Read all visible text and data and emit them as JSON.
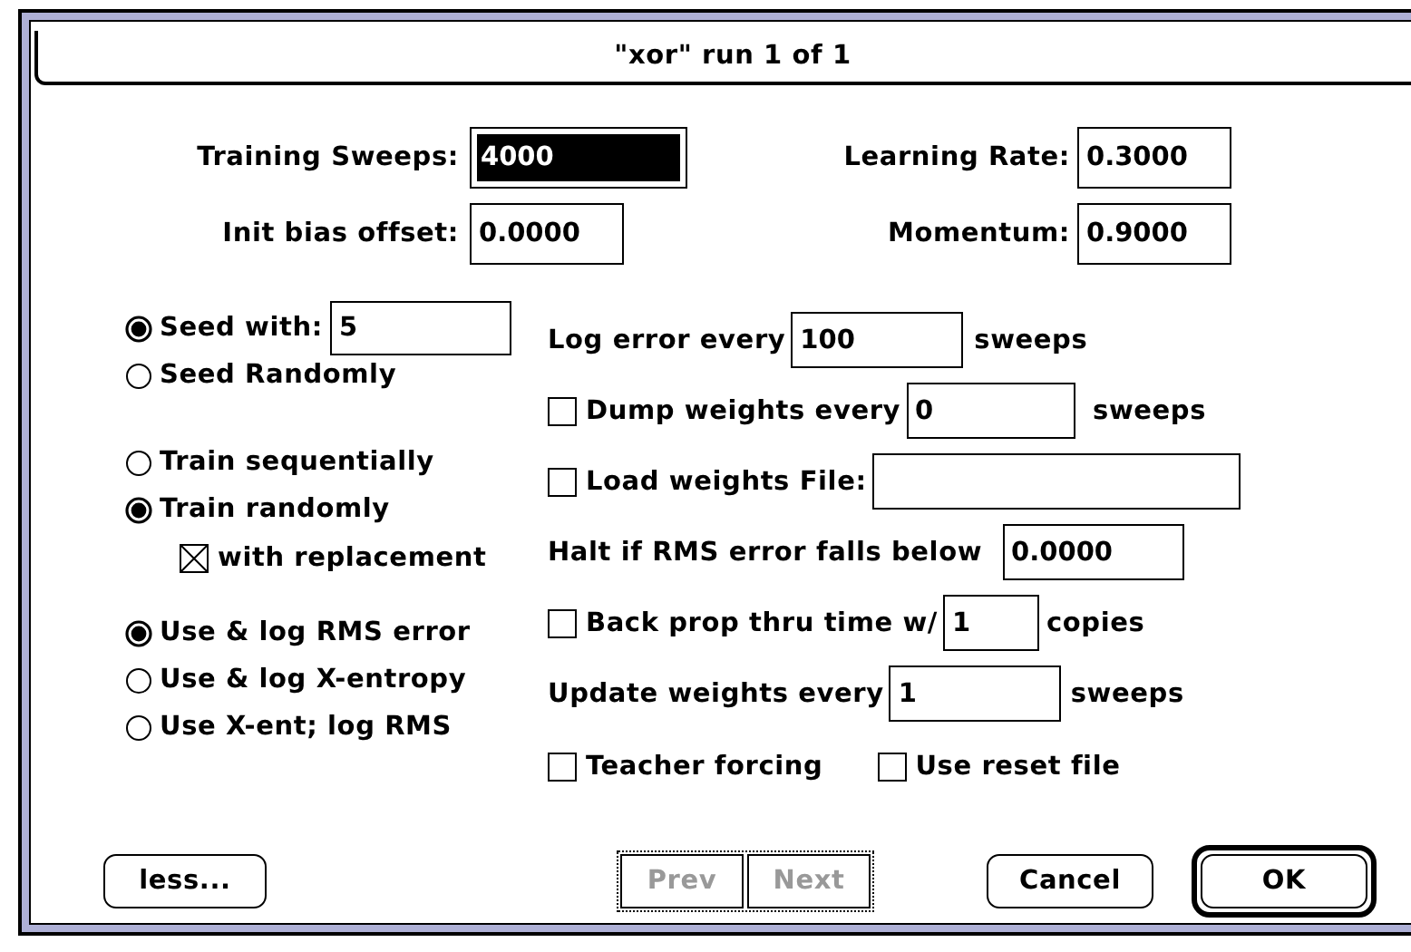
{
  "window": {
    "title": "\"xor\" run 1 of 1"
  },
  "parameters": [
    {
      "label": "Training Sweeps:",
      "value": "4000",
      "selected": true
    },
    {
      "label": "Learning Rate:",
      "value": "0.3000",
      "selected": false
    },
    {
      "label": "Init bias offset:",
      "value": "0.0000",
      "selected": false
    },
    {
      "label": "Momentum:",
      "value": "0.9000",
      "selected": false
    }
  ],
  "seed_options": [
    {
      "label": "Seed with:",
      "selected": true,
      "value": "5"
    },
    {
      "label": "Seed Randomly",
      "selected": false
    }
  ],
  "order_options": [
    {
      "label": "Train sequentially",
      "selected": false
    },
    {
      "label": "Train randomly",
      "selected": true
    }
  ],
  "with_replacement": {
    "label": "with replacement",
    "checked": true
  },
  "error_options": [
    {
      "label": "Use & log RMS error",
      "selected": true
    },
    {
      "label": "Use & log X-entropy",
      "selected": false
    },
    {
      "label": "Use X-ent; log RMS",
      "selected": false
    }
  ],
  "settings": [
    {
      "kind": "field",
      "label": "Log error every",
      "value": "100",
      "unit": "sweeps"
    },
    {
      "kind": "check_field",
      "checked": false,
      "label": "Dump weights every",
      "value": "0",
      "unit": "sweeps"
    },
    {
      "kind": "check_field",
      "checked": false,
      "label": "Load weights File:"
    },
    {
      "kind": "field",
      "label": "Halt if RMS error falls below",
      "value": "0.0000"
    },
    {
      "kind": "check_field",
      "checked": false,
      "label": "Back prop thru time w/",
      "value": "1",
      "unit": "copies"
    },
    {
      "kind": "field",
      "label": "Update weights every",
      "value": "1",
      "unit": "sweeps"
    }
  ],
  "options": [
    {
      "label": "Teacher forcing",
      "checked": false
    },
    {
      "label": "Use reset file",
      "checked": false
    }
  ],
  "buttons": [
    {
      "label": "less...",
      "disabled": false,
      "default": false
    },
    {
      "label": "Prev",
      "disabled": true
    },
    {
      "label": "Next",
      "disabled": true
    },
    {
      "label": "Cancel",
      "disabled": false,
      "default": false
    },
    {
      "label": "OK",
      "disabled": false,
      "default": true
    }
  ]
}
